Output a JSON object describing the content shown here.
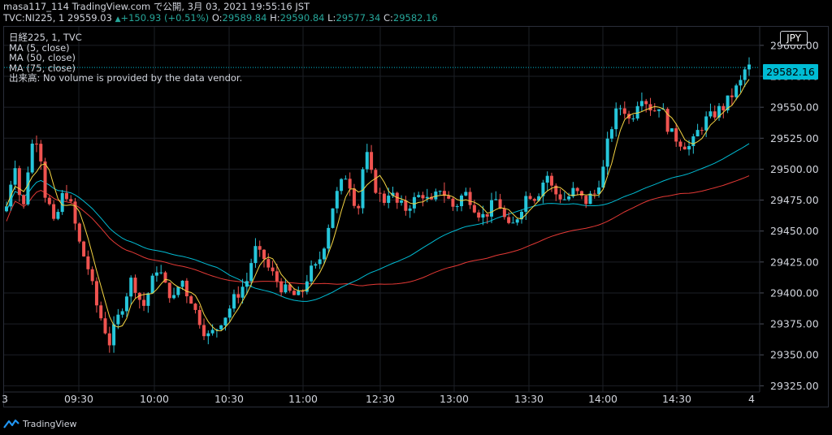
{
  "header": {
    "line1": "masa117_114 TradingView.com で公開, 3月 03, 2021 19:55:16 JST",
    "symbol": "TVC:NI225, 1",
    "last": "29559.03",
    "change": "+150.93 (+0.51%)",
    "o_label": "O:",
    "o_value": "29589.84",
    "h_label": "H:",
    "h_value": "29590.84",
    "l_label": "L:",
    "l_value": "29577.34",
    "c_label": "C:",
    "c_value": "29582.16"
  },
  "legend": {
    "title": "日経225, 1, TVC",
    "ma5": "MA (5, close)",
    "ma50": "MA (50, close)",
    "ma75": "MA (75, close)",
    "volume_note": "出来高: No volume is provided by the data vendor."
  },
  "currency": "JPY",
  "price_tag": "29582.16",
  "watermark": "TradingView",
  "colors": {
    "up": "#26a69a",
    "down": "#ef5350",
    "candle_up": "#26c6da",
    "candle_down": "#ef5350",
    "ma5": "#f5d442",
    "ma50": "#00bcd4",
    "ma75": "#e53935",
    "grid": "#1c1f26",
    "accent": "#00bcd4"
  },
  "chart_data": {
    "type": "candlestick",
    "title": "日経225, 1, TVC",
    "ylim": [
      29320,
      29615
    ],
    "yticks": [
      29325,
      29350,
      29375,
      29400,
      29425,
      29450,
      29475,
      29500,
      29525,
      29550,
      29575,
      29600
    ],
    "ytick_labels": [
      "29325.00",
      "29350.00",
      "29375.00",
      "29400.00",
      "29425.00",
      "29450.00",
      "29475.00",
      "29500.00",
      "29525.00",
      "29550.00",
      "29575.00",
      "29600.00"
    ],
    "xticks": [
      "3",
      "09:30",
      "10:00",
      "10:30",
      "11:00",
      "12:30",
      "13:00",
      "13:30",
      "14:00",
      "14:30",
      "4"
    ],
    "series": [
      {
        "name": "MA (5, close)",
        "color": "#f5d442"
      },
      {
        "name": "MA (50, close)",
        "color": "#00bcd4"
      },
      {
        "name": "MA (75, close)",
        "color": "#e53935"
      }
    ],
    "close_path": [
      29470,
      29490,
      29505,
      29480,
      29470,
      29500,
      29520,
      29525,
      29510,
      29480,
      29470,
      29455,
      29465,
      29478,
      29480,
      29470,
      29455,
      29440,
      29430,
      29420,
      29405,
      29390,
      29380,
      29370,
      29360,
      29370,
      29380,
      29390,
      29400,
      29410,
      29405,
      29395,
      29390,
      29400,
      29410,
      29420,
      29415,
      29405,
      29400,
      29395,
      29405,
      29410,
      29400,
      29395,
      29385,
      29378,
      29370,
      29365,
      29368,
      29372,
      29378,
      29382,
      29388,
      29395,
      29400,
      29405,
      29410,
      29425,
      29435,
      29430,
      29428,
      29420,
      29415,
      29410,
      29405,
      29402,
      29400,
      29398,
      29397,
      29402,
      29412,
      29418,
      29420,
      29428,
      29440,
      29455,
      29470,
      29480,
      29488,
      29495,
      29488,
      29475,
      29470,
      29500,
      29510,
      29495,
      29485,
      29478,
      29475,
      29482,
      29478,
      29472,
      29470,
      29468,
      29472,
      29475,
      29478,
      29480,
      29475,
      29472,
      29478,
      29485,
      29480,
      29475,
      29470,
      29472,
      29478,
      29480,
      29476,
      29470,
      29465,
      29462,
      29465,
      29470,
      29475,
      29470,
      29460,
      29452,
      29455,
      29462,
      29470,
      29478,
      29480,
      29478,
      29482,
      29490,
      29495,
      29485,
      29480,
      29478,
      29476,
      29478,
      29482,
      29480,
      29476,
      29474,
      29478,
      29480,
      29490,
      29500,
      29520,
      29535,
      29545,
      29550,
      29548,
      29540,
      29545,
      29555,
      29560,
      29555,
      29550,
      29548,
      29552,
      29545,
      29535,
      29528,
      29525,
      29522,
      29520,
      29518,
      29522,
      29530,
      29535,
      29540,
      29542,
      29545,
      29548,
      29550,
      29555,
      29560,
      29565,
      29570,
      29580,
      29582
    ]
  }
}
